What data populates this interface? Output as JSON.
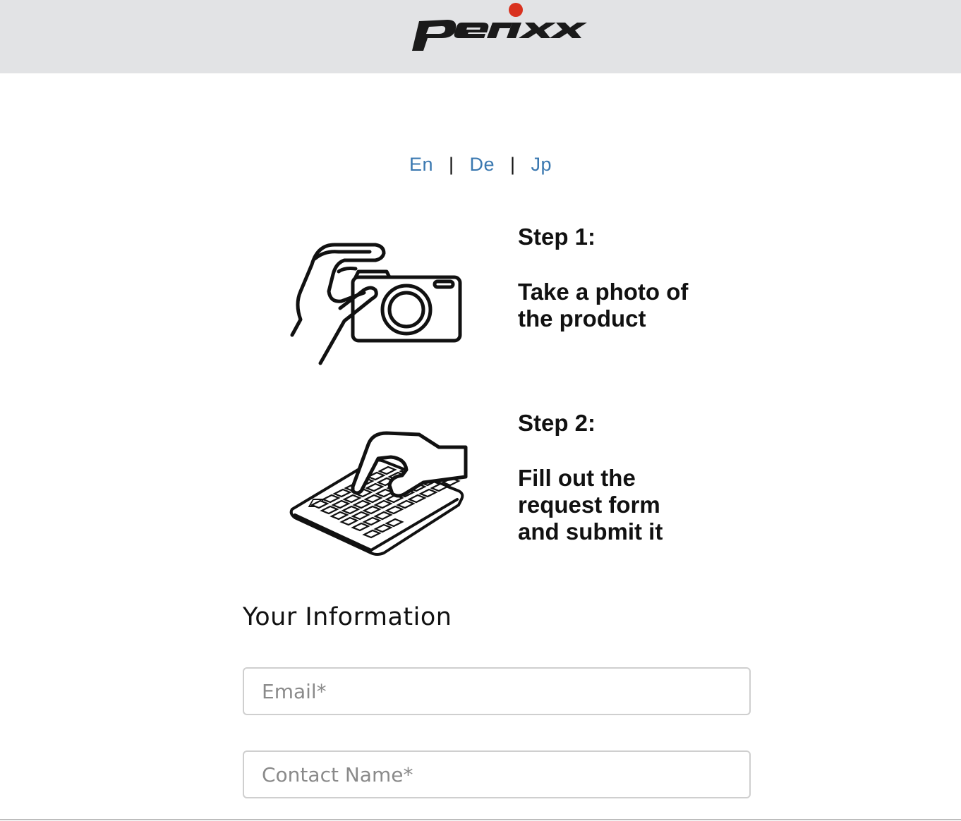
{
  "header": {
    "logo_text": "perixx",
    "brand_dot_color": "#d9321f"
  },
  "languages": [
    {
      "label": "En"
    },
    {
      "label": "De"
    },
    {
      "label": "Jp"
    }
  ],
  "language_separator": "|",
  "steps": [
    {
      "title": "Step 1:",
      "description": "Take a photo of\nthe product",
      "icon": "camera-hand-icon"
    },
    {
      "title": "Step 2:",
      "description": "Fill out the\nrequest form\nand submit it",
      "icon": "keyboard-hand-icon"
    }
  ],
  "form": {
    "section_title": "Your Information",
    "email": {
      "placeholder": "Email*",
      "value": ""
    },
    "contact_name": {
      "placeholder": "Contact Name*",
      "value": ""
    }
  },
  "colors": {
    "header_bg": "#e2e3e5",
    "link": "#3a78b0"
  }
}
